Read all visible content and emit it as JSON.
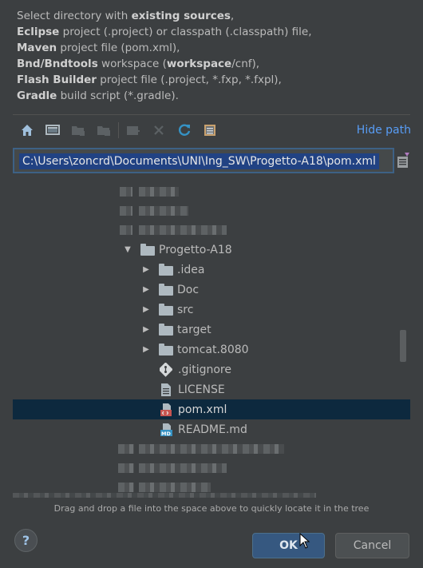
{
  "description": {
    "line1_pre": "Select directory with ",
    "line1_bold": "existing sources",
    "line1_post": ",",
    "line2_bold": "Eclipse",
    "line2_post": " project (.project) or classpath (.classpath) file,",
    "line3_bold": "Maven",
    "line3_post": " project file (pom.xml),",
    "line4_bold": "Bnd/Bndtools",
    "line4_mid": " workspace (",
    "line4_bold2": "workspace",
    "line4_post": "/cnf),",
    "line5_bold": "Flash Builder",
    "line5_post": " project file (.project, *.fxp, *.fxpl),",
    "line6_bold": "Gradle",
    "line6_post": " build script (*.gradle)."
  },
  "toolbar": {
    "buttons": [
      "home-icon",
      "desktop-icon",
      "new-folder-icon",
      "module-folder-icon",
      "show-hidden-icon",
      "delete-icon",
      "refresh-icon",
      "show-path-icon"
    ],
    "hide_path_label": "Hide path"
  },
  "path": {
    "value": "C:\\Users\\zoncrd\\Documents\\UNI\\Ing_SW\\Progetto-A18\\pom.xml"
  },
  "tree": {
    "root_label": "Progetto-A18",
    "folders": [
      ".idea",
      "Doc",
      "src",
      "target",
      "tomcat.8080"
    ],
    "files": [
      ".gitignore",
      "LICENSE",
      "pom.xml",
      "README.md"
    ],
    "selected": "pom.xml"
  },
  "hint": "Drag and drop a file into the space above to quickly locate it in the tree",
  "buttons": {
    "help": "?",
    "ok": "OK",
    "cancel": "Cancel"
  },
  "colors": {
    "background": "#3c3f41",
    "selection": "#0d293e",
    "link": "#589df6",
    "ok_button": "#365880"
  }
}
